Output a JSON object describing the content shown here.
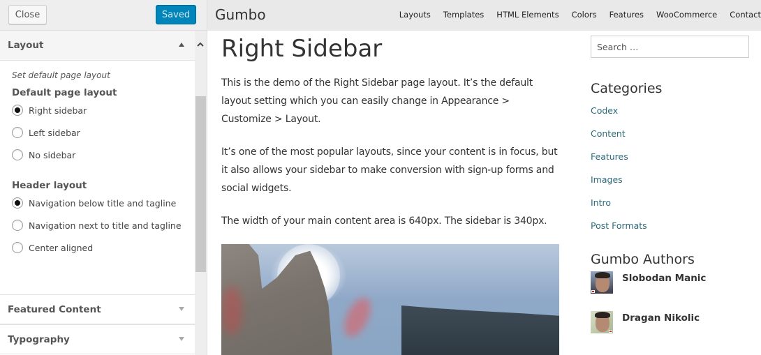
{
  "customizer": {
    "close_label": "Close",
    "save_label": "Saved",
    "save_color": "#0085ba",
    "sections": {
      "layout": {
        "title": "Layout",
        "description": "Set default page layout",
        "default_page_layout": {
          "label": "Default page layout",
          "options": [
            "Right sidebar",
            "Left sidebar",
            "No sidebar"
          ],
          "selected": "Right sidebar"
        },
        "header_layout": {
          "label": "Header layout",
          "options": [
            "Navigation below title and tagline",
            "Navigation next to title and tagline",
            "Center aligned"
          ],
          "selected": "Navigation below title and tagline"
        }
      },
      "featured_content": {
        "title": "Featured Content"
      },
      "typography": {
        "title": "Typography"
      }
    }
  },
  "site": {
    "title": "Gumbo",
    "nav": [
      "Layouts",
      "Templates",
      "HTML Elements",
      "Colors",
      "Features",
      "WooCommerce",
      "Contact"
    ]
  },
  "page": {
    "title": "Right Sidebar",
    "paragraphs": [
      "This is the demo of the Right Sidebar page layout. It’s the default layout setting which you can easily change in Appearance > Customize > Layout.",
      "It’s one of the most popular layouts, since your content is in focus, but it also allows your sidebar to make conversion with sign-up forms and social widgets.",
      "The width of your main content area is 640px. The sidebar is 340px."
    ],
    "image_alt": "Sun behind stone ruin wall with mountains"
  },
  "sidebar": {
    "search_placeholder": "Search …",
    "categories_title": "Categories",
    "categories": [
      "Codex",
      "Content",
      "Features",
      "Images",
      "Intro",
      "Post Formats"
    ],
    "link_color": "#2a6a7c",
    "authors_title": "Gumbo Authors",
    "authors": [
      "Slobodan Manic",
      "Dragan Nikolic"
    ]
  }
}
